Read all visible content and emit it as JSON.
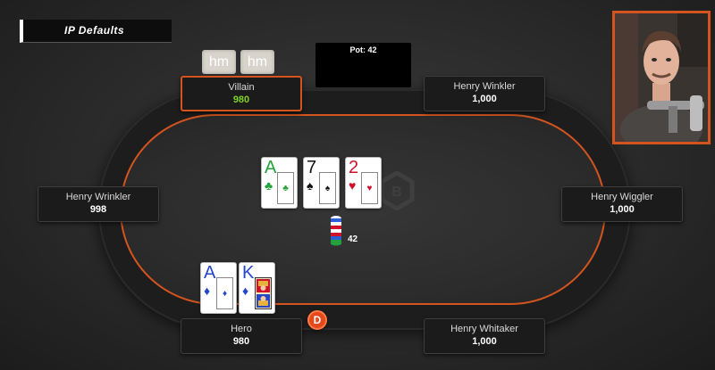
{
  "banner": {
    "title": "IP Defaults"
  },
  "pot": {
    "label": "Pot: 42",
    "amount": "42"
  },
  "seats": {
    "villain": {
      "name": "Villain",
      "stack": "980",
      "notes": [
        "hm",
        "hm"
      ]
    },
    "top_right": {
      "name": "Henry Winkler",
      "stack": "1,000"
    },
    "left": {
      "name": "Henry Wrinkler",
      "stack": "998"
    },
    "right": {
      "name": "Henry Wiggler",
      "stack": "1,000"
    },
    "hero": {
      "name": "Hero",
      "stack": "980"
    },
    "bottom_right": {
      "name": "Henry Whitaker",
      "stack": "1,000"
    }
  },
  "board": [
    {
      "rank": "A",
      "suit": "♣",
      "suit_name": "clubs",
      "color": "green"
    },
    {
      "rank": "7",
      "suit": "♠",
      "suit_name": "spades",
      "color": "black"
    },
    {
      "rank": "2",
      "suit": "♥",
      "suit_name": "hearts",
      "color": "red"
    }
  ],
  "hero_cards": [
    {
      "rank": "A",
      "suit": "♦",
      "suit_name": "diamonds",
      "color": "blue"
    },
    {
      "rank": "K",
      "suit": "♦",
      "suit_name": "diamonds",
      "color": "blue"
    }
  ],
  "dealer_button": {
    "label": "D"
  },
  "colors": {
    "accent": "#d3541f",
    "felt": "#2e2e2e",
    "villain_stack": "#7ed321"
  }
}
